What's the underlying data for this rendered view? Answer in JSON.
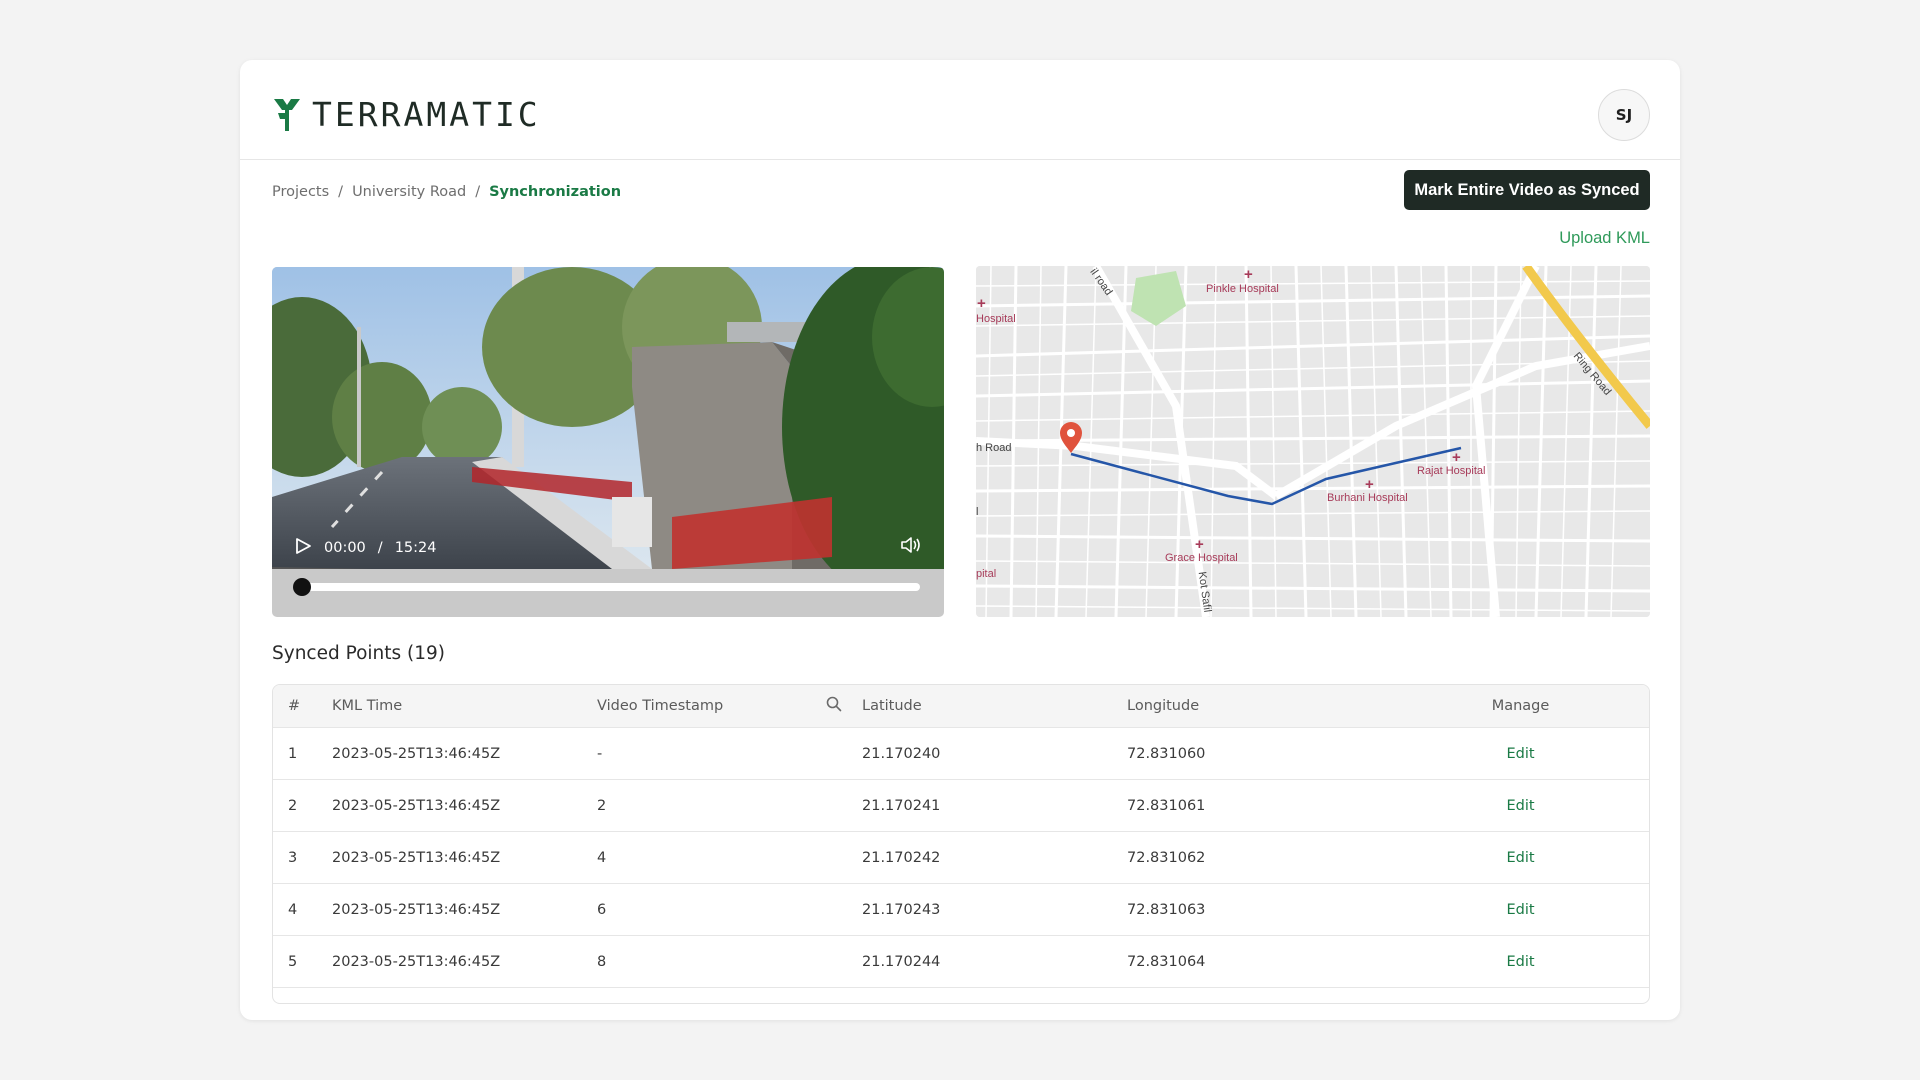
{
  "app": {
    "logo_text": "TERRAMATIC",
    "brand_color": "#1a7a45",
    "avatar_initials": "SJ"
  },
  "breadcrumb": {
    "items": [
      "Projects",
      "University Road"
    ],
    "separator": "/",
    "current": "Synchronization"
  },
  "actions": {
    "mark_synced_label": "Mark Entire Video as Synced",
    "upload_kml_label": "Upload KML"
  },
  "video": {
    "current_time": "00:00",
    "time_separator": "/",
    "duration": "15:24",
    "progress": 0
  },
  "map": {
    "labels": {
      "pinkle": "Pinkle Hospital",
      "hospital_left": "Hospital",
      "road_left": "h Road",
      "rajat": "Rajat Hospital",
      "burhani": "Burhani Hospital",
      "grace": "Grace Hospital",
      "pital": "pital",
      "ring_road": "Ring Road",
      "kot_safil": "Kot Safil",
      "top_road": "il road",
      "edge_l": "l"
    }
  },
  "synced": {
    "title": "Synced Points (19)",
    "columns": {
      "num": "#",
      "kml_time": "KML Time",
      "video_ts": "Video Timestamp",
      "lat": "Latitude",
      "lon": "Longitude",
      "manage": "Manage"
    },
    "rows": [
      {
        "num": "1",
        "kml_time": "2023-05-25T13:46:45Z",
        "video_ts": "-",
        "lat": "21.170240",
        "lon": "72.831060",
        "action": "Edit"
      },
      {
        "num": "2",
        "kml_time": "2023-05-25T13:46:45Z",
        "video_ts": "2",
        "lat": "21.170241",
        "lon": "72.831061",
        "action": "Edit"
      },
      {
        "num": "3",
        "kml_time": "2023-05-25T13:46:45Z",
        "video_ts": "4",
        "lat": "21.170242",
        "lon": "72.831062",
        "action": "Edit"
      },
      {
        "num": "4",
        "kml_time": "2023-05-25T13:46:45Z",
        "video_ts": "6",
        "lat": "21.170243",
        "lon": "72.831063",
        "action": "Edit"
      },
      {
        "num": "5",
        "kml_time": "2023-05-25T13:46:45Z",
        "video_ts": "8",
        "lat": "21.170244",
        "lon": "72.831064",
        "action": "Edit"
      }
    ]
  }
}
